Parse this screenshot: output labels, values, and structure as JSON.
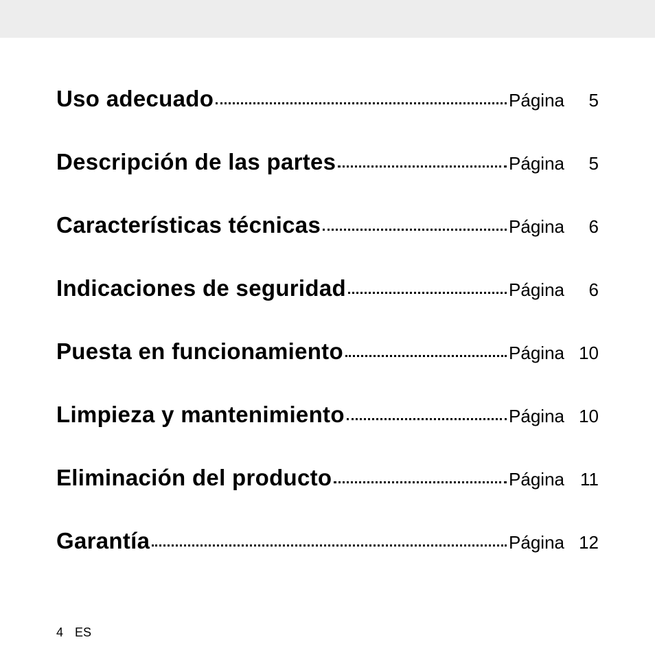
{
  "toc": {
    "page_label": "Página",
    "entries": [
      {
        "title": "Uso adecuado",
        "page": "5"
      },
      {
        "title": "Descripción de las partes",
        "page": "5"
      },
      {
        "title": "Características técnicas",
        "page": "6"
      },
      {
        "title": "Indicaciones de seguridad",
        "page": "6"
      },
      {
        "title": "Puesta en funcionamiento",
        "page": "10"
      },
      {
        "title": "Limpieza y mantenimiento",
        "page": "10"
      },
      {
        "title": "Eliminación del producto",
        "page": "11"
      },
      {
        "title": "Garantía",
        "page": "12"
      }
    ]
  },
  "footer": {
    "page_number": "4",
    "lang": "ES"
  }
}
